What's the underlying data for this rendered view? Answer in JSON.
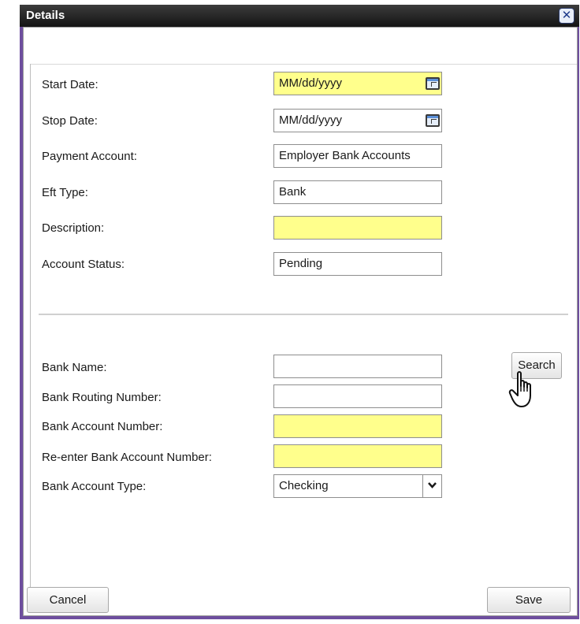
{
  "dialog": {
    "title": "Details",
    "close_glyph": "✕"
  },
  "form": {
    "start_date": {
      "label": "Start Date:",
      "placeholder": "MM/dd/yyyy"
    },
    "stop_date": {
      "label": "Stop Date:",
      "placeholder": "MM/dd/yyyy"
    },
    "payment_account": {
      "label": "Payment Account:",
      "value": "Employer Bank Accounts"
    },
    "eft_type": {
      "label": "Eft Type:",
      "value": "Bank"
    },
    "description": {
      "label": "Description:",
      "value": ""
    },
    "account_status": {
      "label": "Account Status:",
      "value": "Pending"
    }
  },
  "bank": {
    "bank_name": {
      "label": "Bank Name:",
      "value": ""
    },
    "routing_number": {
      "label": "Bank Routing Number:",
      "value": ""
    },
    "account_number": {
      "label": "Bank Account Number:",
      "value": ""
    },
    "reenter_account_number": {
      "label": "Re-enter Bank Account Number:",
      "value": ""
    },
    "account_type": {
      "label": "Bank Account Type:",
      "selected": "Checking"
    },
    "search_button": "Search"
  },
  "footer": {
    "cancel": "Cancel",
    "save": "Save"
  },
  "colors": {
    "required_field": "#ffff8c",
    "title_bar": "#1e1e1e",
    "frame": "#6e4e9e"
  },
  "icons": {
    "close": "close-icon",
    "calendar": "calendar-icon",
    "dropdown": "chevron-down-icon",
    "pointer": "hand-pointer-icon"
  }
}
